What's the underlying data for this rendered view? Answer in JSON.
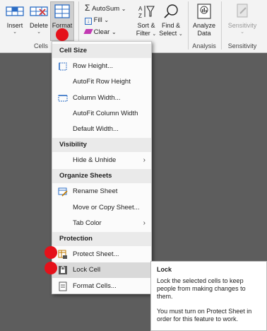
{
  "ribbon": {
    "cells_group": {
      "label": "Cells",
      "insert": "Insert",
      "delete": "Delete",
      "format": "Format"
    },
    "editing_group": {
      "autosum": "AutoSum",
      "fill": "Fill",
      "clear": "Clear",
      "sort_filter_1": "Sort &",
      "sort_filter_2": "Filter",
      "find_select_1": "Find &",
      "find_select_2": "Select"
    },
    "analysis_group": {
      "label": "Analysis",
      "analyze_1": "Analyze",
      "analyze_2": "Data"
    },
    "sensitivity_group": {
      "label": "Sensitivity",
      "button": "Sensitivity"
    }
  },
  "menu": {
    "sections": [
      {
        "header": "Cell Size"
      },
      {
        "header": "Visibility"
      },
      {
        "header": "Organize Sheets"
      },
      {
        "header": "Protection"
      }
    ],
    "items": {
      "row_height": "Row Height...",
      "autofit_row_height": "AutoFit Row Height",
      "column_width": "Column Width...",
      "autofit_column_width": "AutoFit Column Width",
      "default_width": "Default Width...",
      "hide_unhide": "Hide & Unhide",
      "rename_sheet": "Rename Sheet",
      "move_copy_sheet": "Move or Copy Sheet...",
      "tab_color": "Tab Color",
      "protect_sheet": "Protect Sheet...",
      "lock_cell": "Lock Cell",
      "format_cells": "Format Cells..."
    }
  },
  "tooltip": {
    "title": "Lock",
    "line1": "Lock the selected cells to keep people from making changes to them.",
    "line2": "You must turn on Protect Sheet in order for this feature to work."
  },
  "colors": {
    "accent_blue": "#2b6cc4",
    "marker_red": "#e5111a",
    "canvas_gray": "#5d5d5d"
  }
}
